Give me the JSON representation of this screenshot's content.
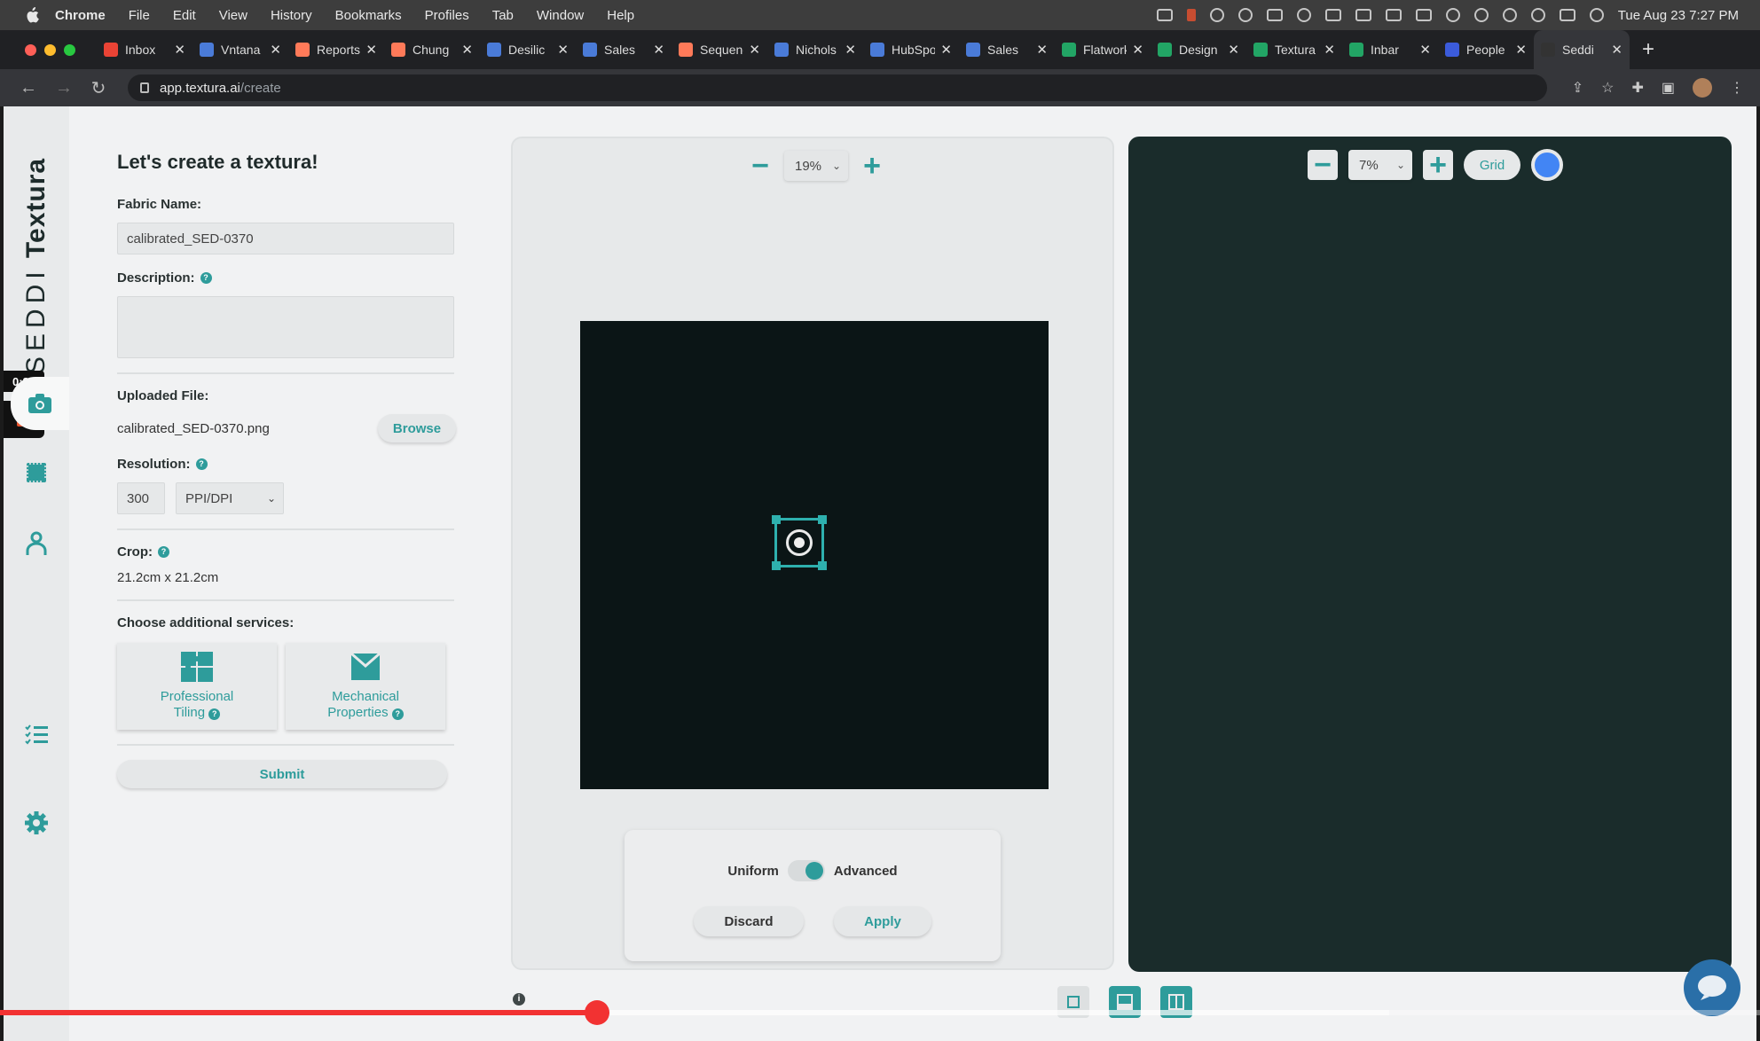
{
  "menubar": {
    "items": [
      "Chrome",
      "File",
      "Edit",
      "View",
      "History",
      "Bookmarks",
      "Profiles",
      "Tab",
      "Window",
      "Help"
    ],
    "datetime": "Tue Aug 23  7:27 PM"
  },
  "tabs": [
    {
      "label": "Inbox",
      "color": "#ea4335"
    },
    {
      "label": "Vntana",
      "color": "#4a7bd8"
    },
    {
      "label": "Reports",
      "color": "#ff7a59"
    },
    {
      "label": "Chung",
      "color": "#ff7a59"
    },
    {
      "label": "Desilic",
      "color": "#4a7bd8"
    },
    {
      "label": "Sales",
      "color": "#4a7bd8"
    },
    {
      "label": "Sequence",
      "color": "#ff7a59"
    },
    {
      "label": "Nichols",
      "color": "#4a7bd8"
    },
    {
      "label": "HubSpot",
      "color": "#4a7bd8"
    },
    {
      "label": "Sales",
      "color": "#4a7bd8"
    },
    {
      "label": "Flatwork",
      "color": "#22a565"
    },
    {
      "label": "Design",
      "color": "#22a565"
    },
    {
      "label": "Textura",
      "color": "#22a565"
    },
    {
      "label": "Inbar",
      "color": "#22a565"
    },
    {
      "label": "People",
      "color": "#3b5bdb"
    },
    {
      "label": "Seddi",
      "color": "#333333"
    }
  ],
  "address": {
    "domain": "app.textura.ai",
    "path": "/create"
  },
  "brand": {
    "strong": "Textura",
    "light": "SEDDI"
  },
  "recording": {
    "time": "0:27"
  },
  "form": {
    "title": "Let's create a textura!",
    "fabric_label": "Fabric Name:",
    "fabric_value": "calibrated_SED-0370",
    "description_label": "Description:",
    "description_value": "",
    "uploaded_label": "Uploaded File:",
    "uploaded_value": "calibrated_SED-0370.png",
    "browse": "Browse",
    "resolution_label": "Resolution:",
    "resolution_value": "300",
    "resolution_unit": "PPI/DPI",
    "crop_label": "Crop:",
    "crop_value": "21.2cm x 21.2cm",
    "services_label": "Choose additional services:",
    "service1_line1": "Professional",
    "service1_line2": "Tiling",
    "service2_line1": "Mechanical",
    "service2_line2": "Properties",
    "submit": "Submit"
  },
  "preview": {
    "zoom": "19%",
    "mode_left": "Uniform",
    "mode_right": "Advanced",
    "discard": "Discard",
    "apply": "Apply"
  },
  "result": {
    "zoom": "7%",
    "grid": "Grid"
  },
  "info_icon": "i",
  "colors": {
    "accent": "#2e9c9b",
    "progress": "#f23232"
  },
  "video_progress": 0.339
}
